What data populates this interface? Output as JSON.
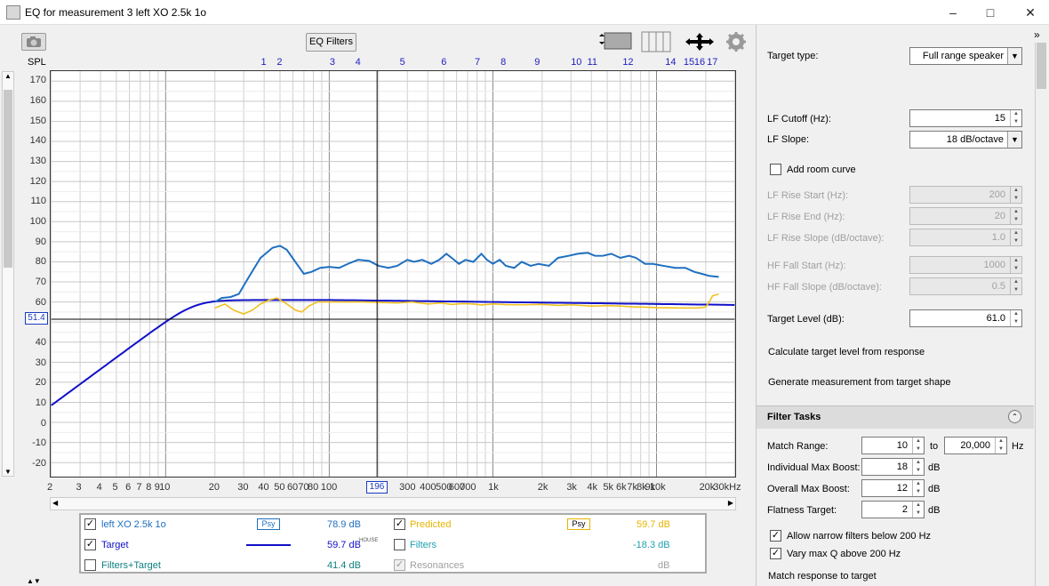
{
  "window": {
    "title": "EQ for measurement 3 left XO 2.5k 1o"
  },
  "toolbar": {
    "eq_filters_label": "EQ Filters"
  },
  "graph": {
    "y_axis_label": "SPL",
    "y_ticks": [
      "170",
      "160",
      "150",
      "140",
      "130",
      "120",
      "110",
      "100",
      "90",
      "80",
      "70",
      "60",
      "50",
      "40",
      "30",
      "20",
      "10",
      "0",
      "-10",
      "-20"
    ],
    "x_ticks": [
      "2",
      "3",
      "4",
      "5",
      "6",
      "7",
      "8",
      "9",
      "10",
      "20",
      "30",
      "40",
      "50",
      "60",
      "70",
      "80",
      "100",
      "200",
      "300",
      "400",
      "500",
      "600",
      "700",
      "1k",
      "2k",
      "3k",
      "4k",
      "5k",
      "6k",
      "7k",
      "8k",
      "9k",
      "10k",
      "20k",
      "30kHz"
    ],
    "filter_numbers": [
      "1",
      "2",
      "3",
      "4",
      "5",
      "6",
      "7",
      "8",
      "9",
      "10",
      "11",
      "12",
      "14",
      "15",
      "16",
      "17"
    ],
    "cursor_level": "51.4",
    "cursor_freq": "196"
  },
  "legend": {
    "row1": {
      "name": "left XO 2.5k 1o",
      "psy": "Psy",
      "value": "78.9 dB",
      "name2": "Predicted",
      "psy2": "Psy",
      "value2": "59.7 dB"
    },
    "row2": {
      "name": "Target",
      "value": "59.7 dB",
      "house": "HOUSE",
      "name2": "Filters",
      "value2": "-18.3 dB"
    },
    "row3": {
      "name": "Filters+Target",
      "value": "41.4 dB",
      "name2": "Resonances",
      "value2": "dB"
    }
  },
  "settings": {
    "target_type_label": "Target type:",
    "target_type_value": "Full range speaker",
    "lf_cutoff_label": "LF Cutoff (Hz):",
    "lf_cutoff_value": "15",
    "lf_slope_label": "LF Slope:",
    "lf_slope_value": "18 dB/octave",
    "add_room_curve_label": "Add room curve",
    "lf_rise_start_label": "LF Rise Start (Hz):",
    "lf_rise_start_value": "200",
    "lf_rise_end_label": "LF Rise End (Hz):",
    "lf_rise_end_value": "20",
    "lf_rise_slope_label": "LF Rise Slope (dB/octave):",
    "lf_rise_slope_value": "1.0",
    "hf_fall_start_label": "HF Fall Start (Hz):",
    "hf_fall_start_value": "1000",
    "hf_fall_slope_label": "HF Fall Slope (dB/octave):",
    "hf_fall_slope_value": "0.5",
    "target_level_label": "Target Level (dB):",
    "target_level_value": "61.0",
    "calc_target_label": "Calculate target level from response",
    "generate_label": "Generate measurement from target shape"
  },
  "filter_tasks": {
    "header": "Filter Tasks",
    "match_range_label": "Match Range:",
    "match_range_from": "10",
    "to_label": "to",
    "match_range_to": "20,000",
    "hz_label": "Hz",
    "max_boost_label": "Individual Max Boost:",
    "max_boost_value": "18",
    "overall_boost_label": "Overall Max Boost:",
    "overall_boost_value": "12",
    "flatness_label": "Flatness Target:",
    "flatness_value": "2",
    "db_label": "dB",
    "allow_narrow_label": "Allow narrow filters below 200 Hz",
    "vary_q_label": "Vary max Q above 200 Hz",
    "match_response_label": "Match response to target"
  },
  "colors": {
    "measurement": "#1f6fc0",
    "target": "#1010c8",
    "predicted": "#f0c020",
    "filters": "#20a0b0"
  }
}
